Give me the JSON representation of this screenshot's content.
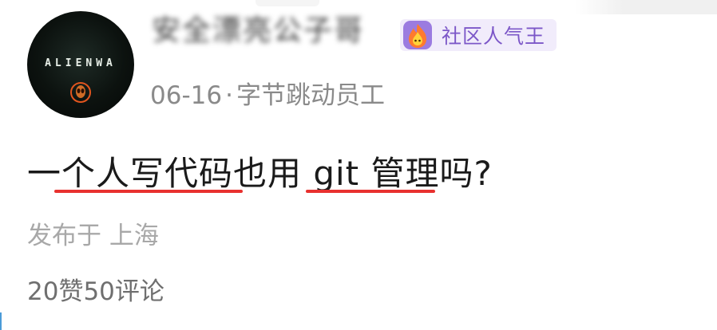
{
  "post": {
    "author_name": "安全漂亮公子哥",
    "author_avatar_text": "ALIENWA",
    "badge_label": "社区人气王",
    "date": "06-16",
    "separator": "·",
    "company": "字节跳动员工",
    "title": "一个人写代码也用 git 管理吗?",
    "location": "发布于 上海",
    "likes": "20赞",
    "comments": "50评论"
  },
  "colors": {
    "accent": "#e8312f",
    "badge_bg": "#f1ecfb",
    "badge_text": "#7c57c8"
  },
  "icons": [
    "alienware-logo-icon",
    "flame-badge-icon"
  ]
}
